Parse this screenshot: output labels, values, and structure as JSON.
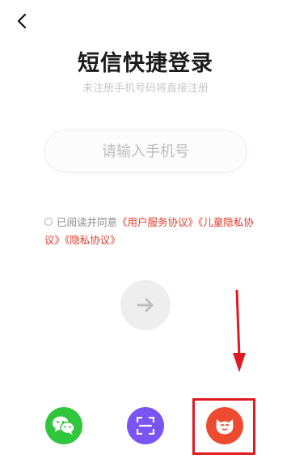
{
  "page": {
    "title": "短信快捷登录",
    "subtitle": "未注册手机号码将直接注册"
  },
  "phone": {
    "placeholder": "请输入手机号",
    "value": ""
  },
  "agreement": {
    "checked": false,
    "prefix": "已阅读并同意",
    "user_service": "《用户服务协议》",
    "child_privacy": "《儿童隐私协议》",
    "privacy": "《隐私协议》"
  },
  "icons": {
    "back": "back-chevron-icon",
    "next": "arrow-right-icon",
    "wechat": "wechat-icon",
    "scan": "scan-icon",
    "pet": "cat-face-icon"
  },
  "colors": {
    "link": "#e63a2a",
    "wechat": "#2fc63d",
    "scan": "#7b55f3",
    "pet": "#ec4b2f",
    "annotation": "#e01a22",
    "next_button": "#eeeeee"
  }
}
